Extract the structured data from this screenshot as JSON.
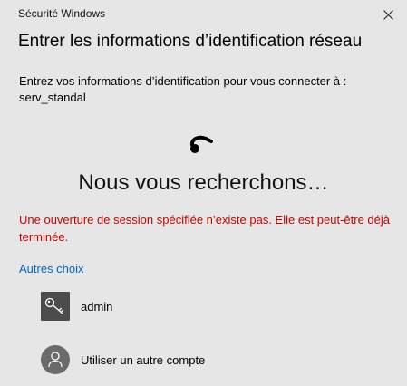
{
  "window": {
    "title": "Sécurité Windows",
    "close_icon": "close-icon"
  },
  "dialog": {
    "heading": "Entrer les informations d’identification réseau",
    "prompt": "Entrez vos informations d’identification pour vous connecter à : serv_standal",
    "status": "Nous vous recherchons…",
    "error": "Une ouverture de session spécifiée n’existe pas. Elle est peut-être déjà terminée.",
    "more_choices": "Autres choix"
  },
  "accounts": [
    {
      "label": "admin",
      "icon": "key-icon"
    },
    {
      "label": "Utiliser un autre compte",
      "icon": "person-icon"
    }
  ],
  "colors": {
    "background": "#e6e6e6",
    "error": "#c50500",
    "link": "#0067c0"
  }
}
